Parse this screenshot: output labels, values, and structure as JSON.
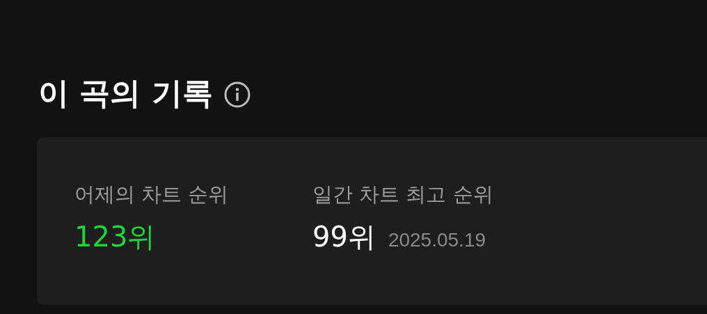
{
  "section": {
    "title": "이 곡의 기록"
  },
  "stats": [
    {
      "label": "어제의 차트 순위",
      "value": "123위",
      "highlighted": true
    },
    {
      "label": "일간 차트 최고 순위",
      "value": "99위",
      "highlighted": false,
      "date": "2025.05.19"
    }
  ]
}
